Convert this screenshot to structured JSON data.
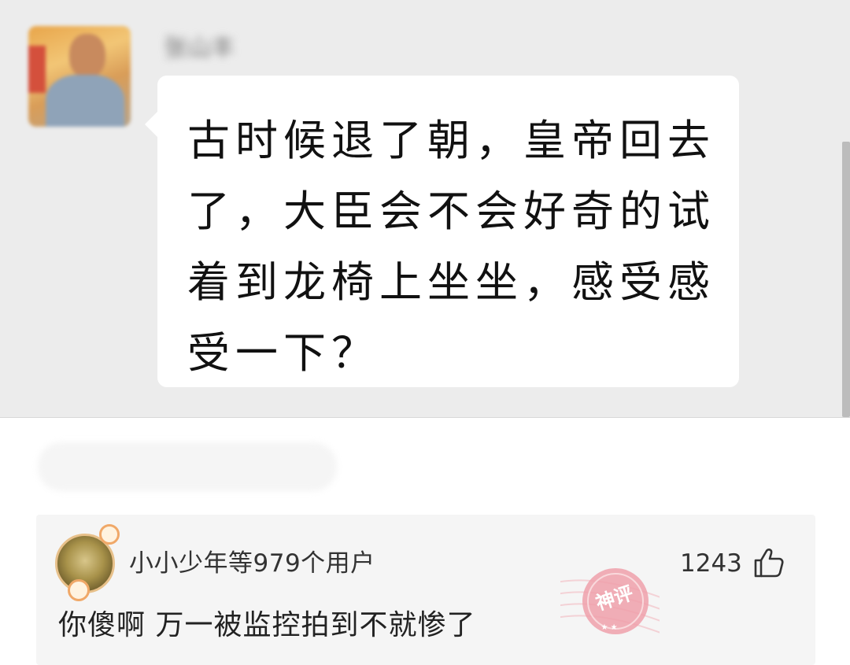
{
  "chat": {
    "username": "张山丰",
    "message": "古时候退了朝，皇帝回去了，大臣会不会好奇的试着到龙椅上坐坐，感受感受一下？"
  },
  "comment": {
    "users_label": "小小少年等979个用户",
    "likes": "1243",
    "text": "你傻啊 万一被监控拍到不就惨了",
    "badge_label": "神评"
  },
  "icons": {
    "like": "thumbs-up-icon",
    "badge": "shenping-stamp-icon"
  },
  "colors": {
    "chat_bg": "#ececec",
    "comment_bg": "#f5f5f5",
    "stamp": "#e88a96"
  }
}
